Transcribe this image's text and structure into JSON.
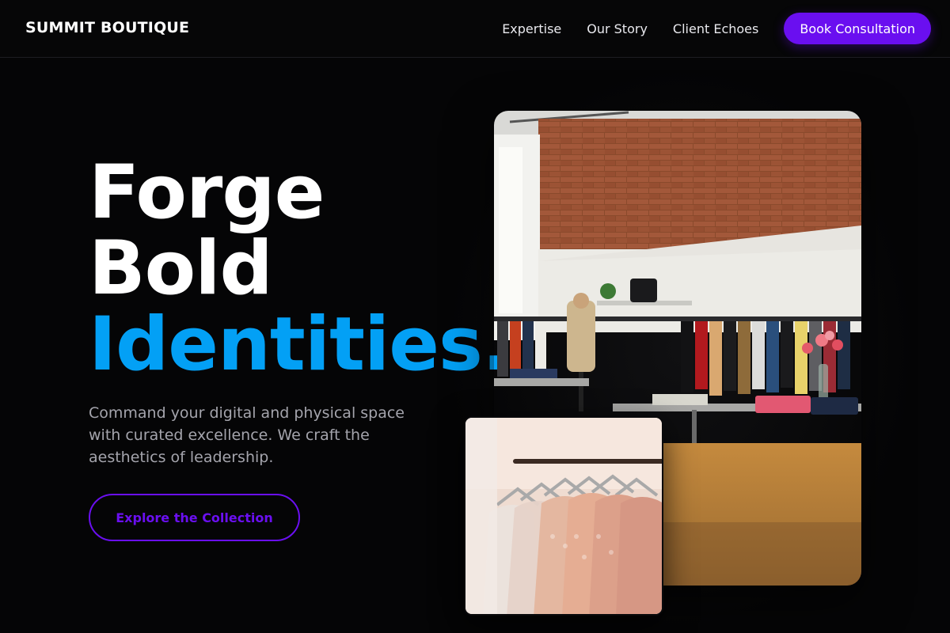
{
  "nav": {
    "brand": "SUMMIT BOUTIQUE",
    "links": [
      {
        "label": "Expertise"
      },
      {
        "label": "Our Story"
      },
      {
        "label": "Client Echoes"
      }
    ],
    "cta_label": "Book Consultation"
  },
  "hero": {
    "headline_line1": "Forge",
    "headline_line2": "Bold",
    "headline_line3": "Identities.",
    "subcopy": "Command your digital and physical space with curated excellence. We craft the aesthetics of leadership.",
    "cta_label": "Explore the Collection"
  },
  "colors": {
    "background": "#050506",
    "accent_purple": "#6a0ff0",
    "accent_blue": "#03a0f5",
    "muted_text": "#a4a4ac"
  }
}
